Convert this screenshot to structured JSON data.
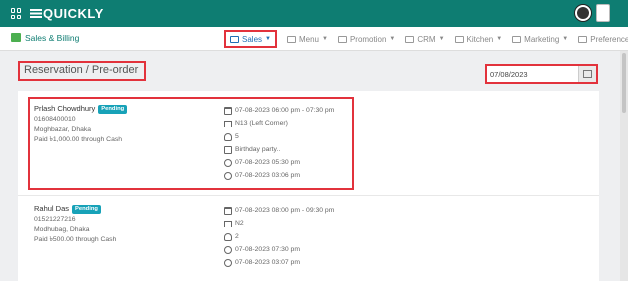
{
  "app": {
    "brand": "QUICKLY"
  },
  "navbar": {
    "module": "Sales & Billing",
    "menu": [
      {
        "label": "Sales",
        "active": true,
        "icon": "sales-icon"
      },
      {
        "label": "Menu",
        "active": false,
        "icon": "menu-icon"
      },
      {
        "label": "Promotion",
        "active": false,
        "icon": "promotion-icon"
      },
      {
        "label": "CRM",
        "active": false,
        "icon": "crm-icon"
      },
      {
        "label": "Kitchen",
        "active": false,
        "icon": "kitchen-icon"
      },
      {
        "label": "Marketing",
        "active": false,
        "icon": "marketing-icon"
      },
      {
        "label": "Preferences",
        "active": false,
        "icon": "gear-icon"
      }
    ]
  },
  "page": {
    "title": "Reservation / Pre-order",
    "date_value": "07/08/2023"
  },
  "reservations": [
    {
      "name": "Prlash Chowdhury",
      "status": "Pending",
      "phone": "01608400010",
      "address": "Moghbazar, Dhaka",
      "payment": "Paid ৳1,000.00 through Cash",
      "datetime": "07-08-2023 06:00 pm - 07:30 pm",
      "table": "N13 (Left Corner)",
      "guests": "5",
      "note": "Birthday party..",
      "reminder": "07-08-2023 05:30 pm",
      "created": "07-08-2023 03:06 pm"
    },
    {
      "name": "Rahul Das",
      "status": "Pending",
      "phone": "01521227216",
      "address": "Modhubag, Dhaka",
      "payment": "Paid ৳500.00 through Cash",
      "datetime": "07-08-2023 08:00 pm - 09:30 pm",
      "table": "N2",
      "guests": "2",
      "reminder": "07-08-2023 07:30 pm",
      "created": "07-08-2023 03:07 pm"
    }
  ],
  "colors": {
    "topbar": "#0e7d72",
    "highlight": "#e2323c",
    "badge": "#17a2b8",
    "active_nav": "#1f6fb5"
  }
}
